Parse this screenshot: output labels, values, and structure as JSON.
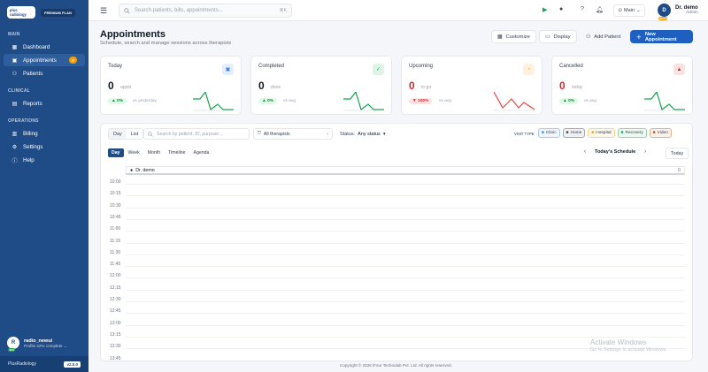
{
  "brand": {
    "logo_text": "plus radiology",
    "plan": "PREMIUM PLAN"
  },
  "sidebar": {
    "sections": [
      {
        "title": "MAIN",
        "items": [
          {
            "label": "Dashboard",
            "icon": "grid-icon"
          },
          {
            "label": "Appointments",
            "icon": "calendar-icon",
            "badge": "0",
            "active": true
          },
          {
            "label": "Patients",
            "icon": "users-icon"
          }
        ]
      },
      {
        "title": "CLINICAL",
        "items": [
          {
            "label": "Reports",
            "icon": "file-icon"
          }
        ]
      },
      {
        "title": "OPERATIONS",
        "items": [
          {
            "label": "Billing",
            "icon": "receipt-icon"
          },
          {
            "label": "Settings",
            "icon": "gear-icon"
          },
          {
            "label": "Help",
            "icon": "help-icon"
          }
        ]
      }
    ],
    "user": {
      "initial": "R",
      "badge": "42%",
      "name": "radio_newui",
      "profile": "Profile 42% complete →"
    },
    "footer": {
      "app": "PlusRadiology",
      "version": "v2.0.0"
    }
  },
  "topbar": {
    "search_placeholder": "Search patients, bills, appointments...",
    "shortcut": "⌘K",
    "branch": "Main",
    "user": {
      "initial": "D",
      "status": "BUSY",
      "name": "Dr. demo",
      "role": "Admin"
    }
  },
  "page": {
    "title": "Appointments",
    "subtitle": "Schedule, search and manage sessions across therapists",
    "actions": {
      "customize": "Customize",
      "display": "Display",
      "add_patient": "Add Patient",
      "new_appointment": "New Appointment"
    }
  },
  "stats": [
    {
      "title": "Today",
      "value": "0",
      "unit": "appts",
      "change": "▲ 0%",
      "compare": "vs yesterday",
      "accent": "#3b82f6",
      "icon": "calendar-icon",
      "line_color": "#16a34a"
    },
    {
      "title": "Completed",
      "value": "0",
      "unit": "done",
      "change": "▲ 0%",
      "compare": "vs avg",
      "accent": "#16a34a",
      "icon": "check-icon",
      "line_color": "#16a34a"
    },
    {
      "title": "Upcoming",
      "value": "0",
      "unit": "to go",
      "change": "▼ 100%",
      "compare": "vs avg",
      "accent": "#f59e0b",
      "icon": "clock-icon",
      "line_color": "#ef4444"
    },
    {
      "title": "Cancelled",
      "value": "0",
      "unit": "today",
      "change": "▲ 0%",
      "compare": "vs avg",
      "accent": "#dc2626",
      "icon": "alert-icon",
      "line_color": "#16a34a"
    }
  ],
  "schedule": {
    "modes": [
      "Day",
      "List"
    ],
    "search_placeholder": "Search by patient, ID, purpose...",
    "therapist_filter": "All therapists",
    "status_label": "Status:",
    "status_value": "Any status",
    "visit_type_label": "VISIT TYPE",
    "visit_types": [
      {
        "label": "Clinic",
        "color": "#3b82f6"
      },
      {
        "label": "Home",
        "color": "#374151"
      },
      {
        "label": "Hospital",
        "color": "#f59e0b"
      },
      {
        "label": "Recovery",
        "color": "#16a34a"
      },
      {
        "label": "Video",
        "color": "#b45309"
      }
    ],
    "views": [
      "Day",
      "Week",
      "Month",
      "Timeline",
      "Agenda"
    ],
    "nav_label": "Today's Schedule",
    "today_button": "Today",
    "column": {
      "name": "Dr. demo",
      "count": "0"
    },
    "times": [
      "10:00",
      "10:15",
      "10:30",
      "10:45",
      "11:00",
      "11:15",
      "11:30",
      "11:45",
      "12:00",
      "12:15",
      "12:30",
      "12:45",
      "13:00",
      "13:15",
      "13:30",
      "13:45"
    ]
  },
  "watermark": {
    "title": "Activate Windows",
    "sub": "Go to Settings to activate Windows."
  },
  "copyright": "Copyright © 2026 iFour Technolab Pvt. Ltd. All rights reserved."
}
